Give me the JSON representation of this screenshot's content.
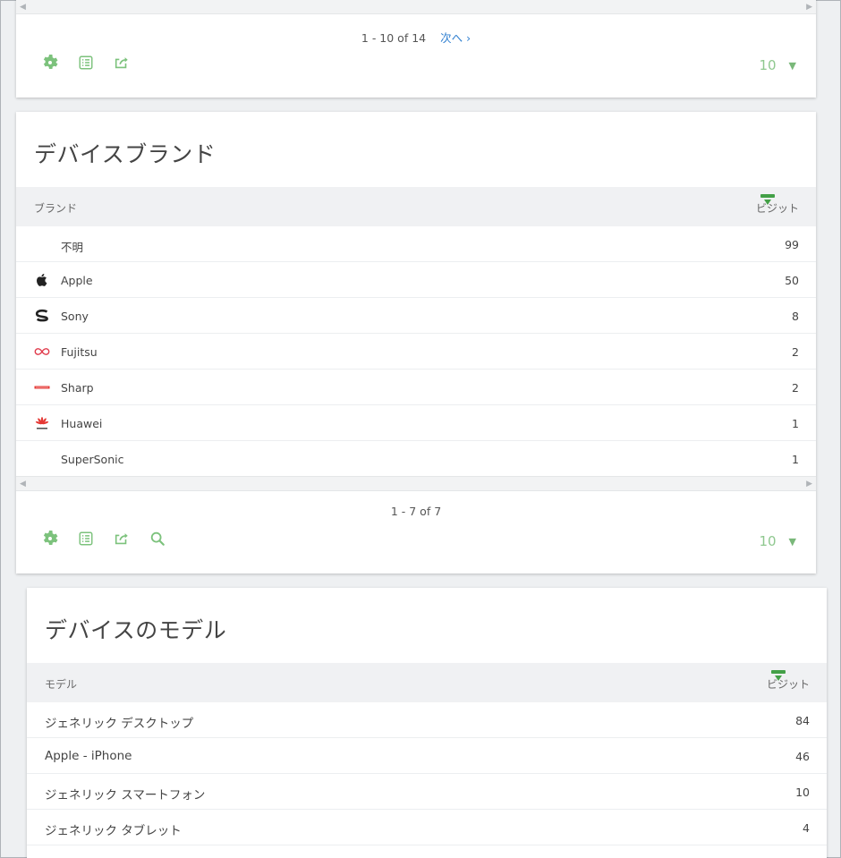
{
  "top_card": {
    "pager_range": "1 - 10 of 14",
    "next_label": "次へ ›",
    "limit_value": "10",
    "tools": [
      {
        "icon": "gear-icon"
      },
      {
        "icon": "table-icon"
      },
      {
        "icon": "export-icon"
      }
    ]
  },
  "brand_card": {
    "title": "デバイスブランド",
    "col_label": "ブランド",
    "col_metric": "ビジット",
    "rows": [
      {
        "label": "不明",
        "value": "99",
        "icon": ""
      },
      {
        "label": "Apple",
        "value": "50",
        "icon": "apple-logo-icon"
      },
      {
        "label": "Sony",
        "value": "8",
        "icon": "sony-logo-icon"
      },
      {
        "label": "Fujitsu",
        "value": "2",
        "icon": "fujitsu-logo-icon"
      },
      {
        "label": "Sharp",
        "value": "2",
        "icon": "sharp-logo-icon"
      },
      {
        "label": "Huawei",
        "value": "1",
        "icon": "huawei-logo-icon"
      },
      {
        "label": "SuperSonic",
        "value": "1",
        "icon": ""
      }
    ],
    "pager_range": "1 - 7 of 7",
    "limit_value": "10",
    "tools": [
      {
        "icon": "gear-icon"
      },
      {
        "icon": "table-icon"
      },
      {
        "icon": "export-icon"
      },
      {
        "icon": "search-icon"
      }
    ]
  },
  "model_card": {
    "title": "デバイスのモデル",
    "col_label": "モデル",
    "col_metric": "ビジット",
    "rows": [
      {
        "label": "ジェネリック デスクトップ",
        "value": "84"
      },
      {
        "label": "Apple - iPhone",
        "value": "46"
      },
      {
        "label": "ジェネリック スマートフォン",
        "value": "10"
      },
      {
        "label": "ジェネリック タブレット",
        "value": "4"
      }
    ]
  },
  "colors": {
    "accent_green": "#8fc88f",
    "sort_green": "#43a047",
    "link_blue": "#2f7fd0"
  }
}
